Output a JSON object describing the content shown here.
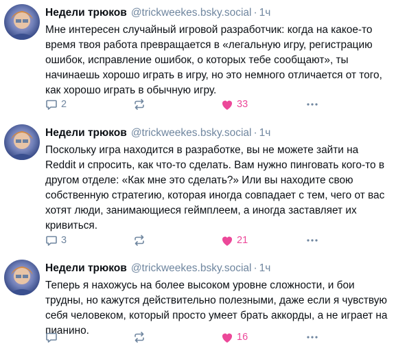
{
  "posts": [
    {
      "author": "Недели трюков",
      "handle": "@trickweekes.bsky.social",
      "separator": "·",
      "time": "1ч",
      "text": "Мне интересен случайный игровой разработчик: когда на какое-то время твоя работа превращается в «легальную игру, регистрацию ошибок, исправление ошибок, о которых тебе сообщают», ты начинаешь хорошо играть в игру, но это немного отличается от того, как хорошо играть в обычную игру.",
      "replies": "2",
      "likes": "33"
    },
    {
      "author": "Недели трюков",
      "handle": "@trickweekes.bsky.social",
      "separator": "·",
      "time": "1ч",
      "text": "Поскольку игра находится в разработке, вы не можете зайти на Reddit и спросить, как что-то сделать. Вам нужно пинговать кого-то в другом отделе: «Как мне это сделать?» Или вы находите свою собственную стратегию, которая иногда совпадает с тем, чего от вас хотят люди, занимающиеся геймплеем, а иногда заставляет их кривиться.",
      "replies": "3",
      "likes": "21"
    },
    {
      "author": "Недели трюков",
      "handle": "@trickweekes.bsky.social",
      "separator": "·",
      "time": "1ч",
      "text": "Теперь я нахожусь на более высоком уровне сложности, и бои трудны, но кажутся действительно полезными, даже если я чувствую себя человеком, который просто умеет брать аккорды, а не играет на пианино.",
      "replies": "",
      "likes": "16"
    }
  ],
  "icons": {
    "reply": "comment-icon",
    "repost": "repost-icon",
    "like": "heart-icon",
    "more": "more-dots-icon"
  },
  "colors": {
    "like": "#ec4899",
    "muted": "#6f869f"
  }
}
